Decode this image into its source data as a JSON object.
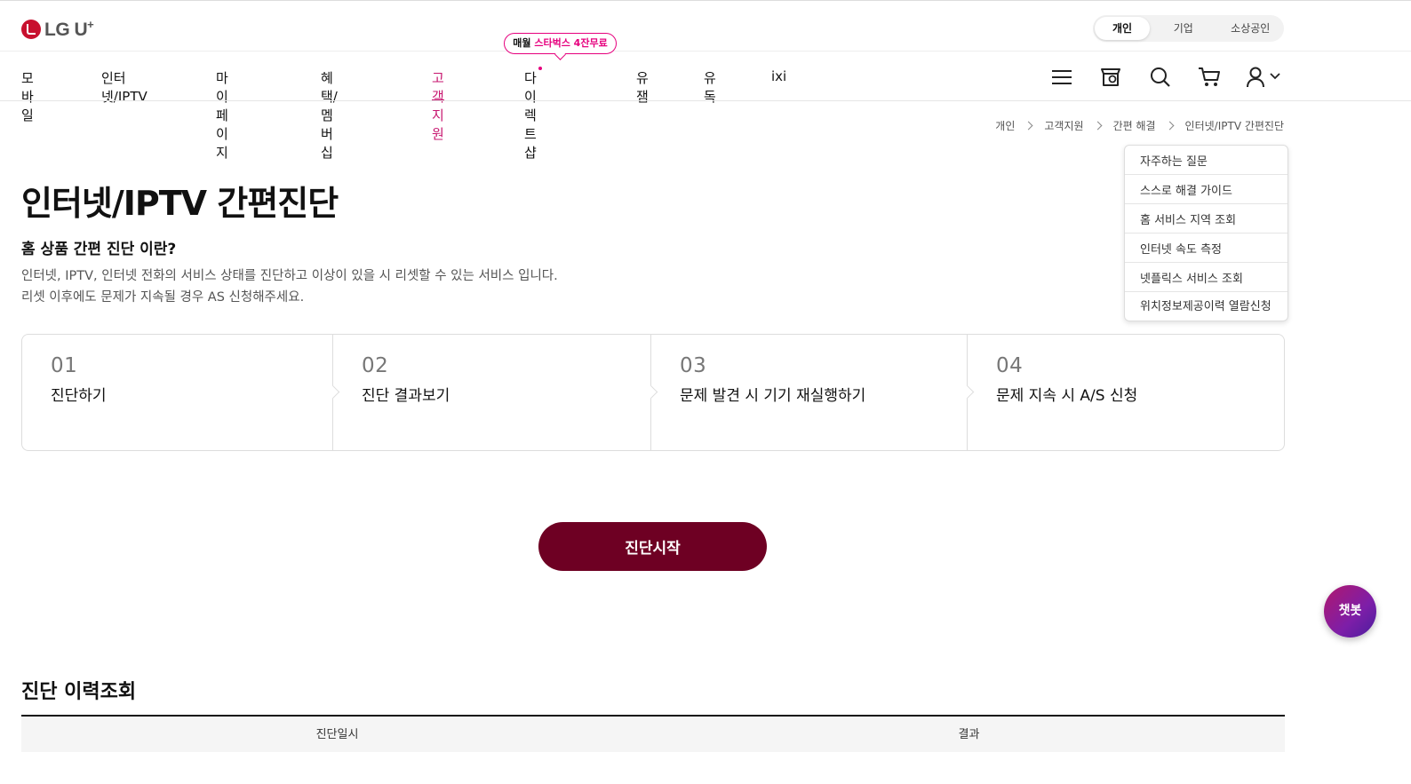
{
  "brand": {
    "logo_text": "LG U",
    "logo_sup": "+"
  },
  "segment": {
    "items": [
      "개인",
      "기업",
      "소상공인"
    ],
    "selected": "개인"
  },
  "promo": {
    "prefix": "매월 ",
    "highlight": "스타벅스 4잔무료"
  },
  "gnb": {
    "items": [
      "모바일",
      "인터넷/IPTV",
      "마이페이지",
      "혜택/멤버십",
      "고객지원",
      "다이렉트샵",
      "유잼",
      "유독",
      "ixi"
    ],
    "active": "고객지원"
  },
  "header_icons": [
    "menu-icon",
    "store-location-icon",
    "search-icon",
    "cart-icon",
    "user-icon",
    "chevron-down-icon"
  ],
  "breadcrumb": [
    "개인",
    "고객지원",
    "간편 해결",
    "인터넷/IPTV 간편진단"
  ],
  "dropdown": [
    "자주하는 질문",
    "스스로 해결 가이드",
    "홈 서비스 지역 조회",
    "인터넷 속도 측정",
    "넷플릭스 서비스 조회",
    "위치정보제공이력 열람신청"
  ],
  "page": {
    "title": "인터넷/IPTV 간편진단",
    "subtitle": "홈 상품 간편 진단 이란?",
    "desc_line1": "인터넷, IPTV, 인터넷 전화의 서비스 상태를 진단하고 이상이 있을 시 리셋할 수 있는 서비스 입니다.",
    "desc_line2": "리셋 이후에도 문제가 지속될 경우 AS 신청해주세요."
  },
  "steps": [
    {
      "num": "01",
      "label": "진단하기"
    },
    {
      "num": "02",
      "label": "진단 결과보기"
    },
    {
      "num": "03",
      "label": "문제 발견 시 기기 재실행하기"
    },
    {
      "num": "04",
      "label": "문제 지속 시 A/S 신청"
    }
  ],
  "start_button": "진단시작",
  "chatbot": "챗봇",
  "history": {
    "title": "진단 이력조회",
    "columns": [
      "진단일시",
      "결과"
    ]
  },
  "colors": {
    "accent": "#c7166f",
    "primary_button": "#6e0023"
  }
}
